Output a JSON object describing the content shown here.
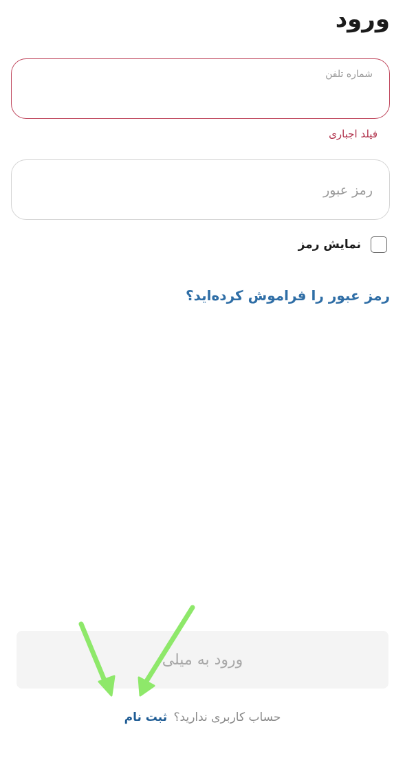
{
  "page": {
    "title": "ورود"
  },
  "phone_field": {
    "label": "شماره تلفن",
    "value": "",
    "error": "فیلد اجباری"
  },
  "password_field": {
    "placeholder": "رمز عبور",
    "value": ""
  },
  "show_password": {
    "label": "نمایش رمز",
    "checked": false
  },
  "forgot_password": {
    "label": "رمز عبور را فراموش کرده‌اید؟"
  },
  "login_button": {
    "label": "ورود به میلی"
  },
  "signup": {
    "prompt": "حساب کاربری ندارید؟",
    "link": "ثبت نام"
  },
  "colors": {
    "error": "#b0304a",
    "link": "#2f6ea6",
    "annotation_arrow": "#8ee86a"
  },
  "icons": {
    "annotation": "arrow-icon"
  }
}
